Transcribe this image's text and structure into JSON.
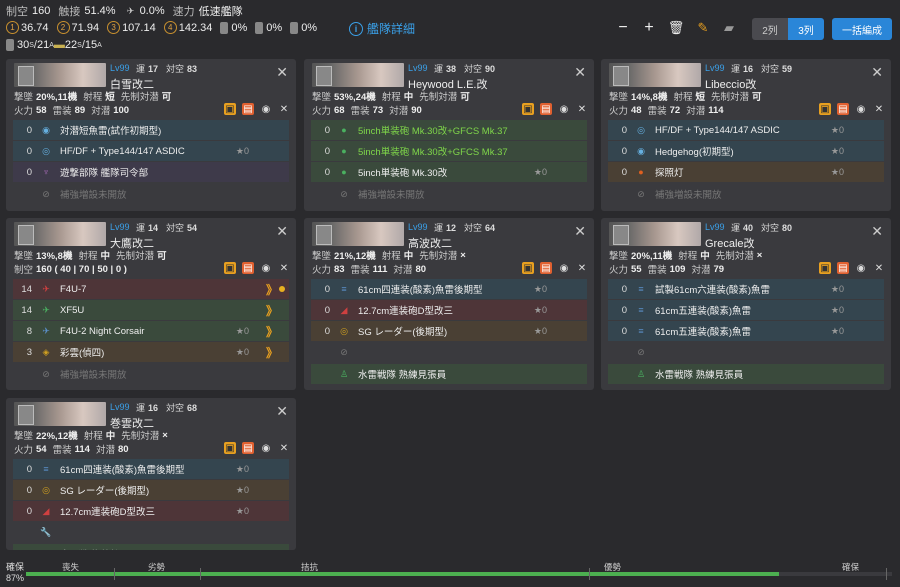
{
  "top": {
    "row1": [
      {
        "k": "制空",
        "v": "160"
      },
      {
        "k": "触接",
        "v": "51.4%"
      },
      {
        "icon": "plane",
        "v": "0.0%"
      },
      {
        "k": "速力",
        "v": "低速艦隊"
      }
    ],
    "row2": [
      {
        "icon": "1",
        "v": "36.74"
      },
      {
        "icon": "2",
        "v": "71.94"
      },
      {
        "icon": "3",
        "v": "107.14"
      },
      {
        "icon": "4",
        "v": "142.34"
      },
      {
        "icon": "drum",
        "v": "0%"
      },
      {
        "icon": "drum",
        "v": "0%"
      },
      {
        "icon": "drum",
        "v": "0%"
      }
    ],
    "row3": {
      "tp_s": "30",
      "tp_s_sub": "S",
      "tp_a": "21",
      "tp_a_sub": "A",
      "tp2_s": "22",
      "tp2_s_sub": "S",
      "tp2_a": "15",
      "tp2_a_sub": "A"
    },
    "detail": "艦隊詳細",
    "cols2": "2列",
    "cols3": "3列",
    "bulk": "一括編成"
  },
  "ships": [
    {
      "lv": "Lv99",
      "luck": "運",
      "luck_v": "17",
      "aa": "対空",
      "aa_v": "83",
      "name": "白雪改二",
      "line1": [
        {
          "k": "撃墜",
          "v": "20%,11機"
        },
        {
          "k": "射程",
          "v": "短"
        },
        {
          "k": "先制対潜",
          "v": "可"
        }
      ],
      "line2": [
        {
          "k": "火力",
          "v": "58"
        },
        {
          "k": "雷装",
          "v": "89"
        },
        {
          "k": "対潜",
          "v": "100"
        }
      ],
      "eq": [
        {
          "c": "blue",
          "s": "0",
          "ic": "sonar",
          "n": "対潜短魚雷(試作初期型)",
          "st": ""
        },
        {
          "c": "blue",
          "s": "0",
          "ic": "radar",
          "n": "HF/DF + Type144/147 ASDIC",
          "st": "★0"
        },
        {
          "c": "violet",
          "s": "0",
          "ic": "crew",
          "n": "遊撃部隊 艦隊司令部",
          "st": ""
        }
      ],
      "ex": "補強増設未開放"
    },
    {
      "lv": "Lv99",
      "luck": "運",
      "luck_v": "38",
      "aa": "対空",
      "aa_v": "90",
      "name": "Heywood L.E.改",
      "line1": [
        {
          "k": "撃墜",
          "v": "53%,24機"
        },
        {
          "k": "射程",
          "v": "中"
        },
        {
          "k": "先制対潜",
          "v": "可"
        }
      ],
      "line2": [
        {
          "k": "火力",
          "v": "68"
        },
        {
          "k": "雷装",
          "v": "73"
        },
        {
          "k": "対潜",
          "v": "90"
        }
      ],
      "eq": [
        {
          "c": "green",
          "s": "0",
          "ic": "gun",
          "n": "5inch単装砲 Mk.30改+GFCS Mk.37",
          "st": "",
          "g": 1
        },
        {
          "c": "green",
          "s": "0",
          "ic": "gun",
          "n": "5inch単装砲 Mk.30改+GFCS Mk.37",
          "st": "",
          "g": 1
        },
        {
          "c": "green",
          "s": "0",
          "ic": "gun",
          "n": "5inch単装砲 Mk.30改",
          "st": "★0"
        }
      ],
      "ex": "補強増設未開放"
    },
    {
      "lv": "Lv99",
      "luck": "運",
      "luck_v": "16",
      "aa": "対空",
      "aa_v": "59",
      "name": "Libeccio改",
      "line1": [
        {
          "k": "撃墜",
          "v": "14%,8機"
        },
        {
          "k": "射程",
          "v": "短"
        },
        {
          "k": "先制対潜",
          "v": "可"
        }
      ],
      "line2": [
        {
          "k": "火力",
          "v": "48"
        },
        {
          "k": "雷装",
          "v": "72"
        },
        {
          "k": "対潜",
          "v": "114"
        }
      ],
      "eq": [
        {
          "c": "blue",
          "s": "0",
          "ic": "radar",
          "n": "HF/DF + Type144/147 ASDIC",
          "st": "★0"
        },
        {
          "c": "blue",
          "s": "0",
          "ic": "sonar",
          "n": "Hedgehog(初期型)",
          "st": "★0"
        },
        {
          "c": "orange",
          "s": "0",
          "ic": "light",
          "n": "探照灯",
          "st": "★0"
        }
      ],
      "ex": "補強増設未開放"
    },
    {
      "lv": "Lv99",
      "luck": "運",
      "luck_v": "14",
      "aa": "対空",
      "aa_v": "54",
      "name": "大鷹改二",
      "line1": [
        {
          "k": "撃墜",
          "v": "13%,8機"
        },
        {
          "k": "射程",
          "v": "中"
        },
        {
          "k": "先制対潜",
          "v": "可"
        }
      ],
      "line2": [
        {
          "k": "制空",
          "v": "160 ( 40 | 70 | 50 | 0 )"
        }
      ],
      "eq": [
        {
          "c": "red",
          "s": "14",
          "ic": "fighter",
          "n": "F4U-7",
          "st": "",
          "pro": "》",
          "dot": 1
        },
        {
          "c": "green",
          "s": "14",
          "ic": "fighter2",
          "n": "XF5U",
          "st": "",
          "pro": "》"
        },
        {
          "c": "green",
          "s": "8",
          "ic": "night",
          "n": "F4U-2 Night Corsair",
          "st": "★0",
          "pro": "》"
        },
        {
          "c": "orange",
          "s": "3",
          "ic": "recon",
          "n": "彩雲(偵四)",
          "st": "★0",
          "pro": "》"
        }
      ],
      "ex": "補強増設未開放"
    },
    {
      "lv": "Lv99",
      "luck": "運",
      "luck_v": "12",
      "aa": "対空",
      "aa_v": "64",
      "name": "高波改二",
      "line1": [
        {
          "k": "撃墜",
          "v": "21%,12機"
        },
        {
          "k": "射程",
          "v": "中"
        },
        {
          "k": "先制対潜",
          "v": "×"
        }
      ],
      "line2": [
        {
          "k": "火力",
          "v": "83"
        },
        {
          "k": "雷装",
          "v": "111"
        },
        {
          "k": "対潜",
          "v": "80"
        }
      ],
      "eq": [
        {
          "c": "blue",
          "s": "0",
          "ic": "torp",
          "n": "61cm四連装(酸素)魚雷後期型",
          "st": "★0"
        },
        {
          "c": "red",
          "s": "0",
          "ic": "gun2",
          "n": "12.7cm連装砲D型改三",
          "st": "★0"
        },
        {
          "c": "orange",
          "s": "0",
          "ic": "radar2",
          "n": "SG レーダー(後期型)",
          "st": "★0"
        },
        {
          "c": "empty",
          "s": "",
          "ic": "ban",
          "n": "",
          "st": ""
        }
      ],
      "ex": "水雷戦隊 熟練見張員",
      "exi": "crew2"
    },
    {
      "lv": "Lv99",
      "luck": "運",
      "luck_v": "40",
      "aa": "対空",
      "aa_v": "80",
      "name": "Grecale改",
      "line1": [
        {
          "k": "撃墜",
          "v": "20%,11機"
        },
        {
          "k": "射程",
          "v": "中"
        },
        {
          "k": "先制対潜",
          "v": "×"
        }
      ],
      "line2": [
        {
          "k": "火力",
          "v": "55"
        },
        {
          "k": "雷装",
          "v": "109"
        },
        {
          "k": "対潜",
          "v": "79"
        }
      ],
      "eq": [
        {
          "c": "blue",
          "s": "0",
          "ic": "torp",
          "n": "試製61cm六連装(酸素)魚雷",
          "st": "★0"
        },
        {
          "c": "blue",
          "s": "0",
          "ic": "torp",
          "n": "61cm五連装(酸素)魚雷",
          "st": "★0"
        },
        {
          "c": "blue",
          "s": "0",
          "ic": "torp",
          "n": "61cm五連装(酸素)魚雷",
          "st": "★0"
        },
        {
          "c": "empty",
          "s": "",
          "ic": "ban",
          "n": "",
          "st": ""
        }
      ],
      "ex": "水雷戦隊 熟練見張員",
      "exi": "crew2"
    },
    {
      "lv": "Lv99",
      "luck": "運",
      "luck_v": "16",
      "aa": "対空",
      "aa_v": "68",
      "name": "巻雲改二",
      "line1": [
        {
          "k": "撃墜",
          "v": "22%,12機"
        },
        {
          "k": "射程",
          "v": "中"
        },
        {
          "k": "先制対潜",
          "v": "×"
        }
      ],
      "line2": [
        {
          "k": "火力",
          "v": "54"
        },
        {
          "k": "雷装",
          "v": "114"
        },
        {
          "k": "対潜",
          "v": "80"
        }
      ],
      "eq": [
        {
          "c": "blue",
          "s": "0",
          "ic": "torp",
          "n": "61cm四連装(酸素)魚雷後期型",
          "st": "★0"
        },
        {
          "c": "orange",
          "s": "0",
          "ic": "radar2",
          "n": "SG レーダー(後期型)",
          "st": "★0"
        },
        {
          "c": "red",
          "s": "0",
          "ic": "gun2",
          "n": "12.7cm連装砲D型改三",
          "st": "★0"
        },
        {
          "c": "empty",
          "s": "",
          "ic": "wrench",
          "n": "",
          "st": ""
        }
      ],
      "ex": "水雷戦隊 熟練見張員",
      "exi": "crew2"
    }
  ],
  "bottom": {
    "air_label": "確保",
    "pct": "87%",
    "fill": 0.87,
    "labels": [
      "喪失",
      "劣勢",
      "拮抗",
      "優勢",
      "確保"
    ]
  }
}
